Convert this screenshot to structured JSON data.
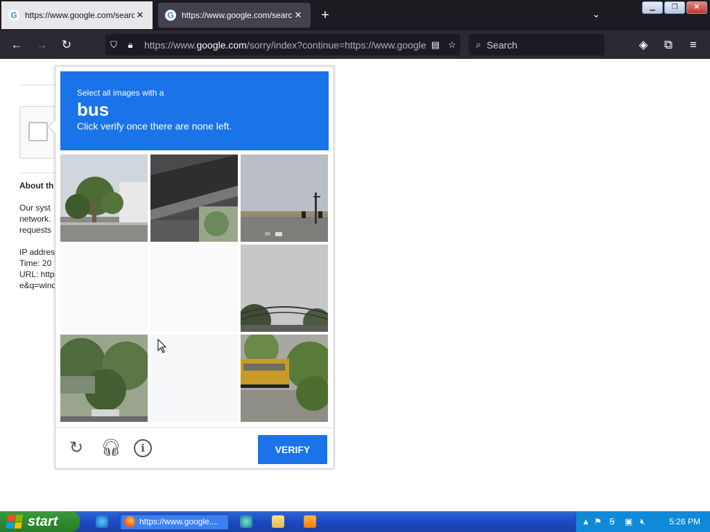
{
  "browser": {
    "tabs": [
      {
        "title": "https://www.google.com/search",
        "close": "✕"
      },
      {
        "title": "https://www.google.com/search",
        "close": "✕"
      }
    ],
    "new_tab": "+",
    "tab_list": "⌄",
    "url": {
      "prefix": "https://www.",
      "domain": "google.com",
      "rest": "/sorry/index?continue=https://www.google"
    },
    "search_placeholder": "Search"
  },
  "page": {
    "about_heading": "About th",
    "lines": [
      "Our syst",
      "network.",
      "requests",
      "",
      "IP addres",
      "Time: 20",
      "URL: http",
      "e&q=wind"
    ]
  },
  "challenge": {
    "line1": "Select all images with a",
    "target": "bus",
    "line3": "Click verify once there are none left.",
    "verify_label": "VERIFY",
    "tiles": [
      {
        "id": "tile-1",
        "scene": "palm-trees",
        "blank": false
      },
      {
        "id": "tile-2",
        "scene": "overpass",
        "blank": false
      },
      {
        "id": "tile-3",
        "scene": "road-traffic-lights",
        "blank": false
      },
      {
        "id": "tile-4",
        "scene": "empty",
        "blank": true
      },
      {
        "id": "tile-5",
        "scene": "empty",
        "blank": true
      },
      {
        "id": "tile-6",
        "scene": "sky-wires",
        "blank": false
      },
      {
        "id": "tile-7",
        "scene": "trees-car",
        "blank": false
      },
      {
        "id": "tile-8",
        "scene": "empty",
        "blank": true
      },
      {
        "id": "tile-9",
        "scene": "school-bus",
        "blank": false
      }
    ]
  },
  "taskbar": {
    "start_label": "start",
    "task_title": "https://www.google....",
    "clock": "5:26 PM"
  },
  "colors": {
    "accent": "#1a73e8",
    "browser_dark": "#1c1b22",
    "taskbar": "#1c48c4",
    "start_green": "#2f8a2f"
  }
}
